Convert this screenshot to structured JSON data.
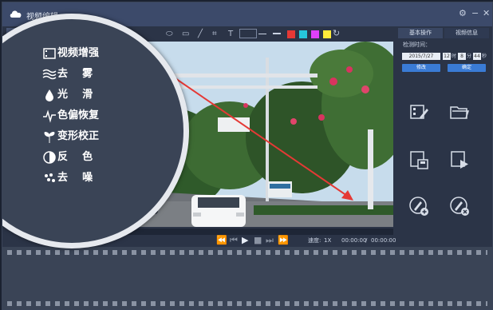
{
  "window": {
    "title": "视频编辑"
  },
  "right_panel": {
    "tabs": [
      "基本操作",
      "视频信息"
    ],
    "time_label": "检测时间：",
    "date_value": "2015/7/27",
    "hour_value": "12",
    "hour_unit": "时",
    "minute_value": "8",
    "minute_unit": "分",
    "second_value": "44",
    "second_unit": "秒",
    "modify_button": "修改",
    "confirm_button": "确定"
  },
  "playback": {
    "speed_label": "速度:",
    "speed_value": "1X",
    "current_time": "00:00:00",
    "separator": "/",
    "total_time": "00:00:00",
    "progress": 0
  },
  "magnifier": {
    "items": [
      {
        "label": "视频增强",
        "icon": "film-enhance-icon"
      },
      {
        "label": "去    雾",
        "icon": "dehaze-waves-icon"
      },
      {
        "label": "光    滑",
        "icon": "smooth-drop-icon"
      },
      {
        "label": "色偏恢复",
        "icon": "color-cast-wave-icon"
      },
      {
        "label": "变形校正",
        "icon": "sprout-correction-icon"
      },
      {
        "label": "反    色",
        "icon": "invert-color-icon"
      },
      {
        "label": "去    噪",
        "icon": "denoise-icon"
      }
    ]
  },
  "colors": {
    "accent": "#3a7bd5",
    "titlebar": "#3c4a6a",
    "panel": "#2b3447",
    "arrow": "#e53935",
    "swatches": [
      "#e53935",
      "#26c6da",
      "#e040fb",
      "#ffeb3b"
    ]
  }
}
